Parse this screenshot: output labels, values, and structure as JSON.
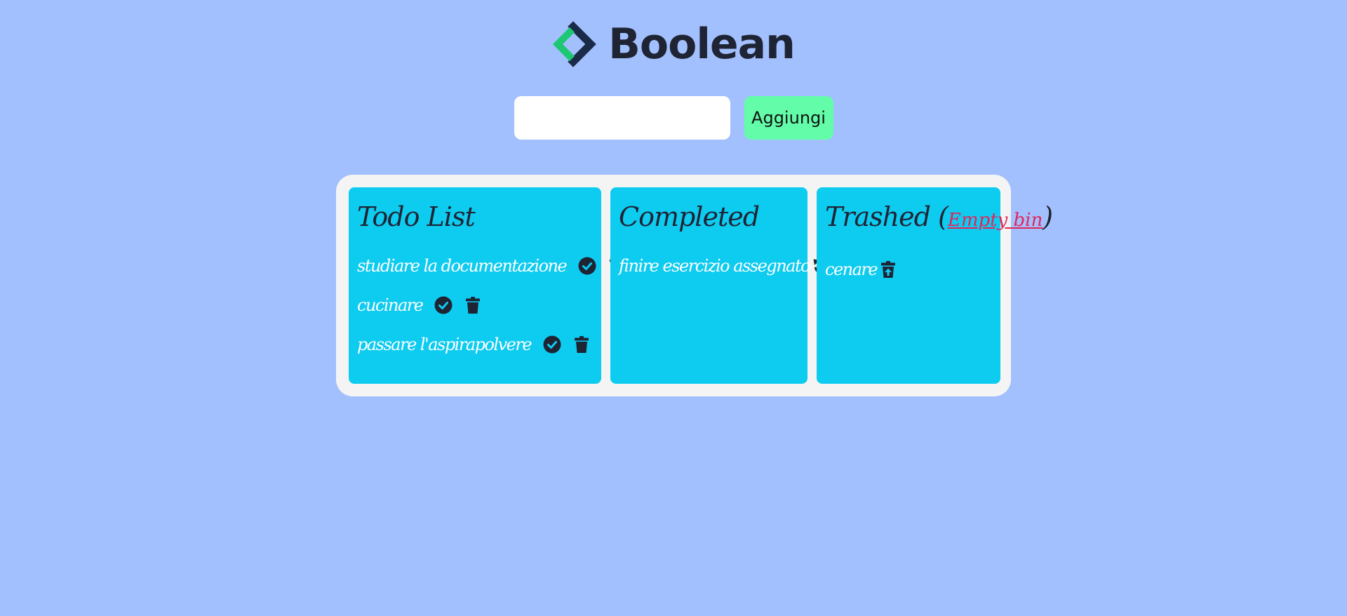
{
  "header": {
    "brand": "Boolean",
    "logo_icon": "boolean-logo-icon"
  },
  "add_form": {
    "input_value": "",
    "input_placeholder": "",
    "add_label": "Aggiungi"
  },
  "columns": {
    "todo": {
      "title": "Todo List",
      "items": [
        {
          "text": "studiare la documentazione"
        },
        {
          "text": "cucinare"
        },
        {
          "text": "passare l'aspirapolvere"
        }
      ],
      "icons": [
        "check-circle-icon",
        "trash-icon"
      ]
    },
    "completed": {
      "title": "Completed",
      "items": [
        {
          "text": "finire esercizio assegnato"
        }
      ],
      "icons": [
        "undo-icon"
      ]
    },
    "trashed": {
      "title_prefix": "Trashed (",
      "empty_label": "Empty bin",
      "title_suffix": ")",
      "items": [
        {
          "text": "cenare"
        }
      ],
      "icons": [
        "trash-restore-icon"
      ]
    }
  },
  "colors": {
    "page_background": "#a2c0fd",
    "board_background": "#f4f4f4",
    "column_background": "#0ecbf0",
    "add_button": "#63fda9",
    "dark_text": "#1e2434",
    "link_red": "#e5245a",
    "logo_green": "#1ec773",
    "logo_navy": "#1a2a48"
  }
}
